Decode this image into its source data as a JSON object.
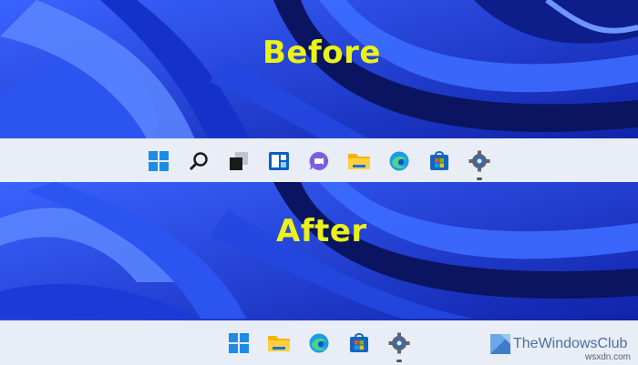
{
  "before": {
    "label": "Before"
  },
  "after": {
    "label": "After"
  },
  "before_taskbar": {
    "icons": [
      "windows-start-icon",
      "search-icon",
      "task-view-icon",
      "widgets-icon",
      "teams-chat-icon",
      "file-explorer-icon",
      "edge-icon",
      "store-icon",
      "settings-icon"
    ]
  },
  "after_taskbar": {
    "icons": [
      "windows-start-icon",
      "file-explorer-icon",
      "edge-icon",
      "store-icon",
      "settings-icon"
    ]
  },
  "watermark": {
    "text": "TheWindowsClub"
  },
  "site": {
    "text": "wsxdn.com"
  },
  "colors": {
    "label": "#eaf21a",
    "taskbar": "#e9edf5",
    "wallpaper": "#1c2fb8"
  }
}
